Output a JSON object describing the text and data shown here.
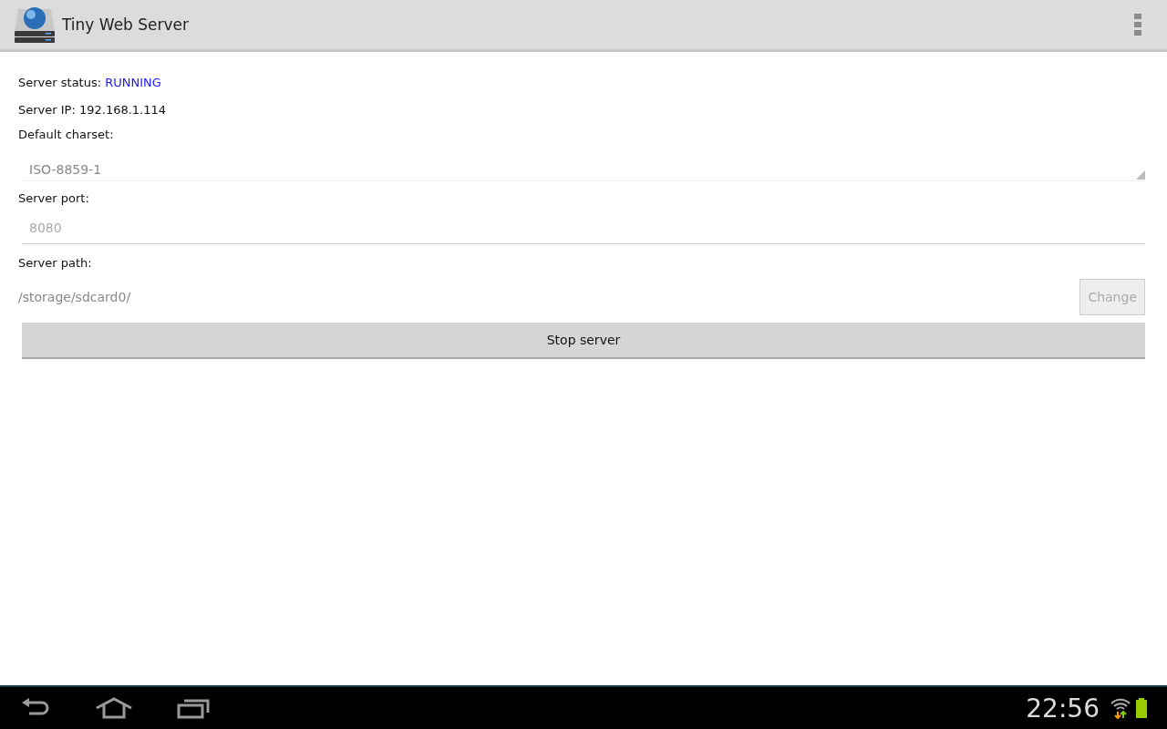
{
  "app_bar": {
    "title": "Tiny Web Server"
  },
  "status": {
    "label": "Server status:",
    "value": "RUNNING",
    "color": "#1a1aff"
  },
  "ip": {
    "label": "Server IP: 192.168.1.114"
  },
  "charset": {
    "label": "Default charset:",
    "value": "ISO-8859-1",
    "disabled": true
  },
  "port": {
    "label": "Server port:",
    "placeholder": "8080",
    "disabled": true
  },
  "path": {
    "label": "Server path:",
    "value": "/storage/sdcard0/",
    "button": {
      "label": "Change",
      "disabled": true
    }
  },
  "main_button": {
    "label": "Stop server"
  },
  "system_bar": {
    "time": "22:56"
  }
}
